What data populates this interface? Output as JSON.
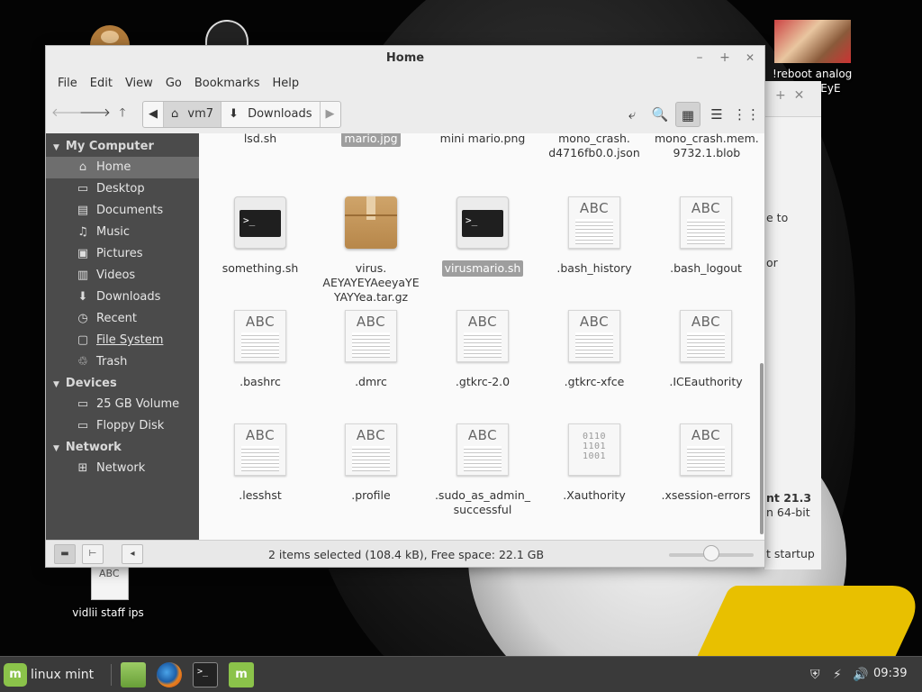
{
  "desktop": {
    "reboot_label_line1": "!reboot analog",
    "reboot_label_line2": "yAEyE",
    "vidlii_label": "vidlii staff ips",
    "doc_icon_text": "ABC"
  },
  "background_window": {
    "text_1": "e to",
    "text_2": "or",
    "text_3": "nt 21.3",
    "text_4": "n 64-bit",
    "text_5": "t startup"
  },
  "window": {
    "title": "Home",
    "controls": {
      "minimize": "–",
      "maximize": "+",
      "close": "✕"
    }
  },
  "menubar": [
    "File",
    "Edit",
    "View",
    "Go",
    "Bookmarks",
    "Help"
  ],
  "pathbar": {
    "segments": [
      {
        "label": "vm7",
        "icon": "home-icon"
      },
      {
        "label": "Downloads",
        "icon": "download-arrow-icon"
      }
    ]
  },
  "sidebar": {
    "sections": [
      {
        "header": "My Computer",
        "items": [
          {
            "label": "Home",
            "icon": "home-icon",
            "active": true
          },
          {
            "label": "Desktop",
            "icon": "desktop-icon"
          },
          {
            "label": "Documents",
            "icon": "documents-icon"
          },
          {
            "label": "Music",
            "icon": "music-icon"
          },
          {
            "label": "Pictures",
            "icon": "pictures-icon"
          },
          {
            "label": "Videos",
            "icon": "videos-icon"
          },
          {
            "label": "Downloads",
            "icon": "downloads-icon"
          },
          {
            "label": "Recent",
            "icon": "recent-icon"
          },
          {
            "label": "File System",
            "icon": "filesystem-icon"
          },
          {
            "label": "Trash",
            "icon": "trash-icon"
          }
        ]
      },
      {
        "header": "Devices",
        "items": [
          {
            "label": "25 GB Volume",
            "icon": "drive-icon"
          },
          {
            "label": "Floppy Disk",
            "icon": "floppy-icon"
          }
        ]
      },
      {
        "header": "Network",
        "items": [
          {
            "label": "Network",
            "icon": "network-icon"
          }
        ]
      }
    ]
  },
  "files": {
    "row0": [
      {
        "name": "lsd.sh",
        "selected": false
      },
      {
        "name": "mario.jpg",
        "selected": true
      },
      {
        "name": "mini mario.png",
        "selected": false
      },
      {
        "name": "mono_crash.\nd4716fb0.0.json",
        "selected": false
      },
      {
        "name": "mono_crash.mem.\n9732.1.blob",
        "selected": false
      }
    ],
    "row1": [
      {
        "name": "something.sh",
        "type": "script",
        "selected": false
      },
      {
        "name": "virus.\nAEYAYEYAeeyaYE\nYAYYea.tar.gz",
        "type": "archive",
        "selected": false
      },
      {
        "name": "virusmario.sh",
        "type": "script",
        "selected": true
      },
      {
        "name": ".bash_history",
        "type": "text",
        "selected": false
      },
      {
        "name": ".bash_logout",
        "type": "text",
        "selected": false
      }
    ],
    "row2": [
      {
        "name": ".bashrc",
        "type": "text"
      },
      {
        "name": ".dmrc",
        "type": "text"
      },
      {
        "name": ".gtkrc-2.0",
        "type": "text"
      },
      {
        "name": ".gtkrc-xfce",
        "type": "text"
      },
      {
        "name": ".ICEauthority",
        "type": "text"
      }
    ],
    "row3": [
      {
        "name": ".lesshst",
        "type": "text"
      },
      {
        "name": ".profile",
        "type": "text"
      },
      {
        "name": ".sudo_as_admin_\nsuccessful",
        "type": "text"
      },
      {
        "name": ".Xauthority",
        "type": "binary"
      },
      {
        "name": ".xsession-errors",
        "type": "text"
      }
    ],
    "text_icon_label": "ABC",
    "binary_icon_label": "0110\n1101\n1001"
  },
  "statusbar": {
    "text": "2 items selected (108.4 kB), Free space: 22.1 GB",
    "zoom_level": 0.5
  },
  "taskbar": {
    "menu_label": "linux mint",
    "clock": "09:39"
  },
  "colors": {
    "sidebar_bg": "#4b4b4b",
    "selection": "#9e9e9e",
    "mint_green": "#8bc34a"
  }
}
